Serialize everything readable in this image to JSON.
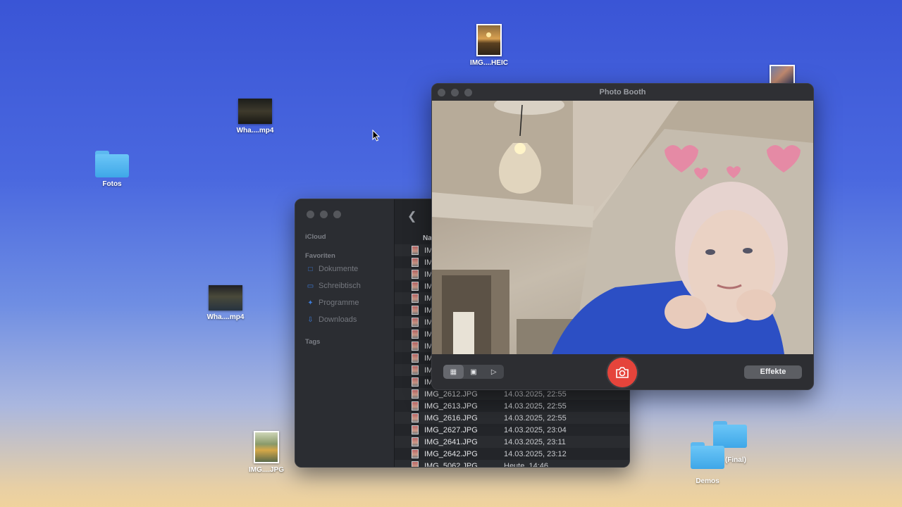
{
  "desktop": {
    "icons": {
      "heic": "IMG....HEIC",
      "video1": "Wha....mp4",
      "fotos": "Fotos",
      "video2": "Wha....mp4",
      "jpg": "IMG....JPG",
      "ep_final": "EP (Final)",
      "demos": "Demos"
    }
  },
  "finder": {
    "sidebar": {
      "icloud": "iCloud",
      "favorites": "Favoriten",
      "items": [
        {
          "label": "Dokumente",
          "icon": "document-icon"
        },
        {
          "label": "Schreibtisch",
          "icon": "desktop-icon"
        },
        {
          "label": "Programme",
          "icon": "applications-icon"
        },
        {
          "label": "Downloads",
          "icon": "downloads-icon"
        }
      ],
      "tags": "Tags"
    },
    "column_header": "Na",
    "partial_rows": [
      "IM",
      "IM",
      "IM",
      "IM",
      "IM",
      "IM",
      "IM",
      "IM",
      "IM",
      "IM",
      "IM",
      "IM"
    ],
    "rows": [
      {
        "name": "IMG_2612.JPG",
        "date": "14.03.2025, 22:55"
      },
      {
        "name": "IMG_2613.JPG",
        "date": "14.03.2025, 22:55"
      },
      {
        "name": "IMG_2616.JPG",
        "date": "14.03.2025, 22:55"
      },
      {
        "name": "IMG_2627.JPG",
        "date": "14.03.2025, 23:04"
      },
      {
        "name": "IMG_2641.JPG",
        "date": "14.03.2025, 23:11"
      },
      {
        "name": "IMG_2642.JPG",
        "date": "14.03.2025, 23:12"
      },
      {
        "name": "IMG_5062.JPG",
        "date": "Heute, 14:46"
      }
    ]
  },
  "photobooth": {
    "title": "Photo Booth",
    "effects_button": "Effekte",
    "view_modes": [
      "grid-icon",
      "portrait-icon",
      "video-icon"
    ],
    "accent": "#e5443b"
  }
}
